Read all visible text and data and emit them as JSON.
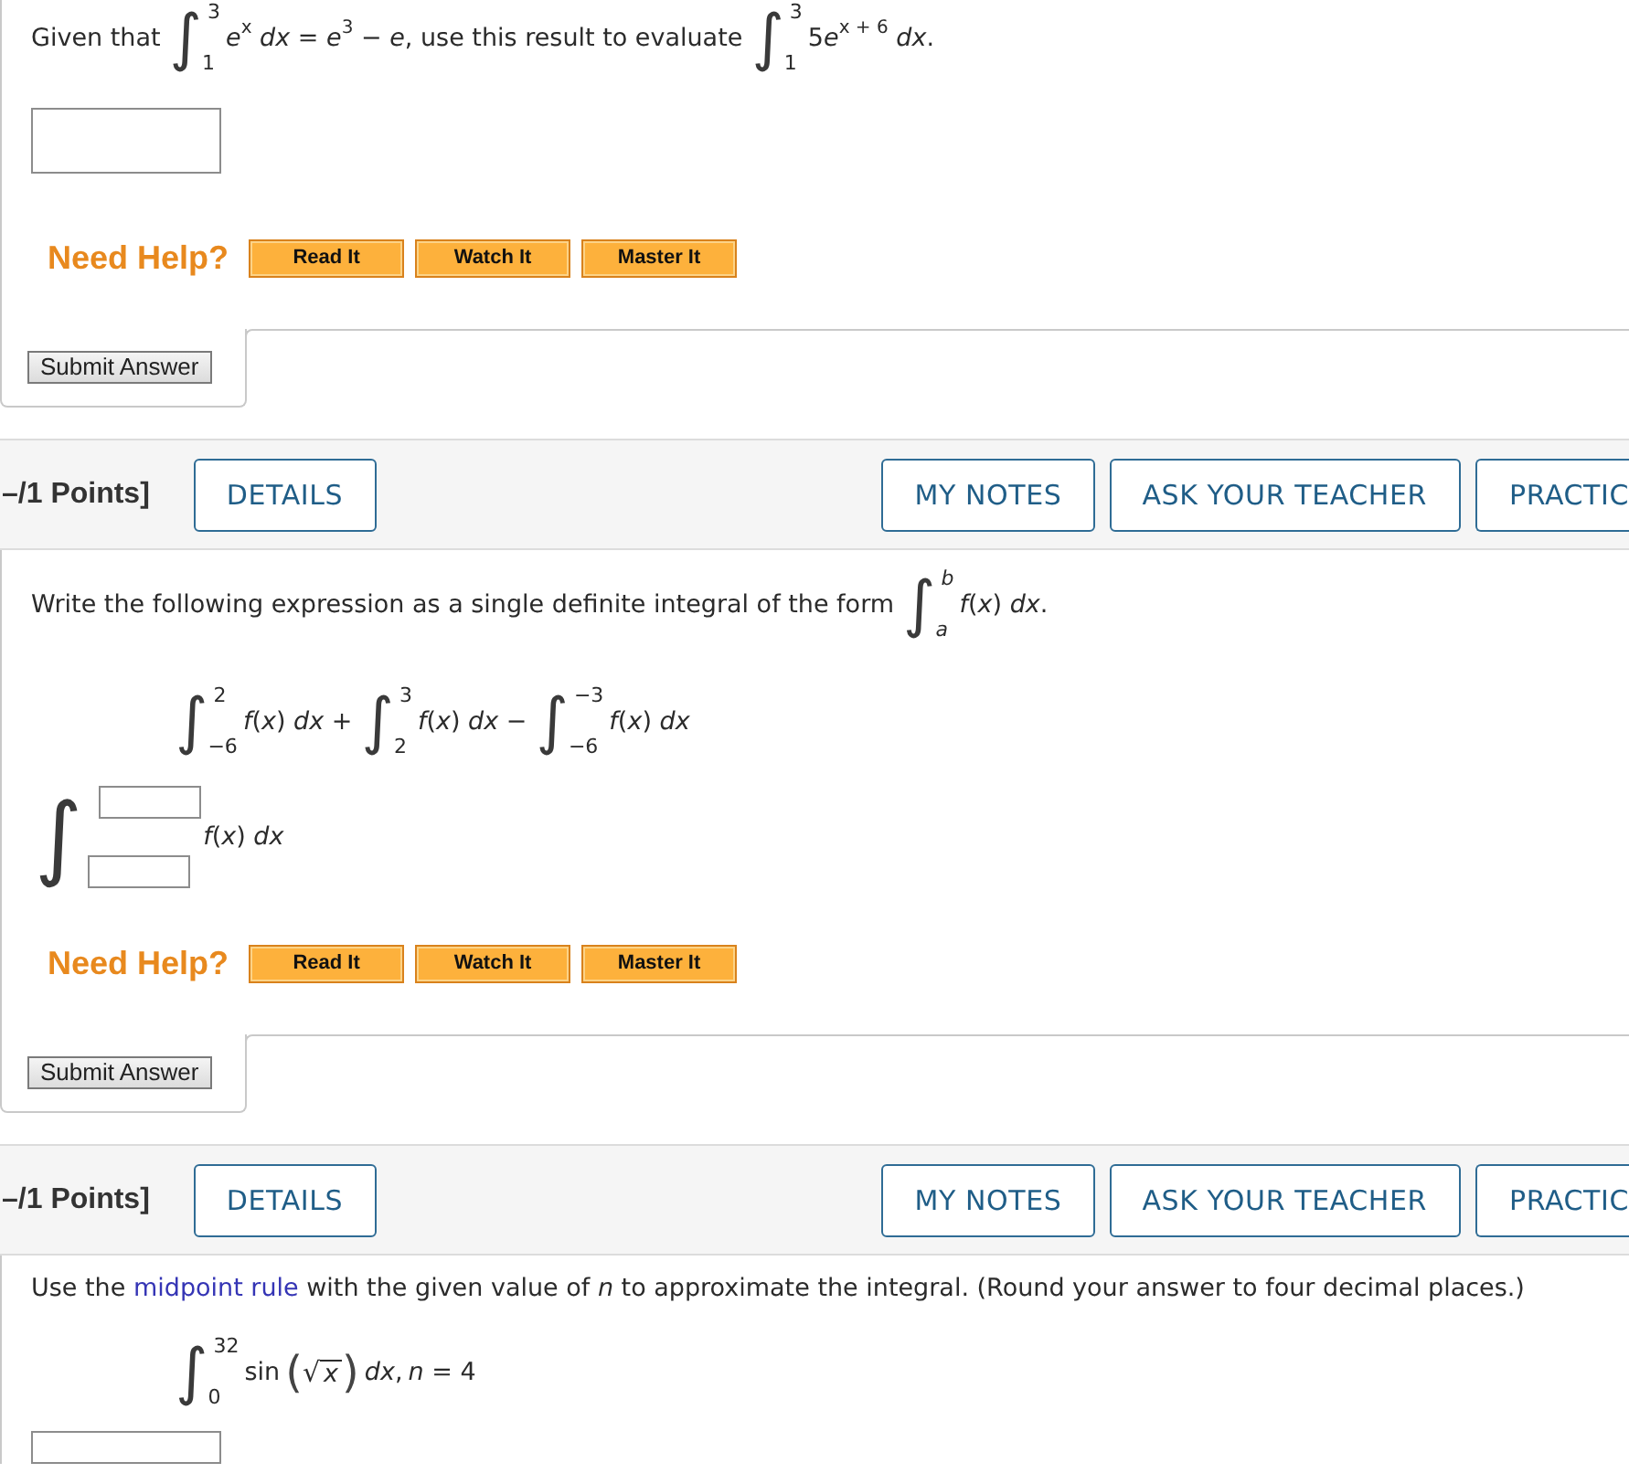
{
  "questions": [
    {
      "prompt": [
        {
          "kind": "text",
          "text": "Given that"
        },
        {
          "kind": "integral",
          "sign": "∫",
          "upper": "3",
          "lower": "1"
        },
        {
          "kind": "text",
          "text": "*e*$^{x}$ *dx* = *e*$^{3}$ − *e*, use this result to evaluate"
        },
        {
          "kind": "integral",
          "sign": "∫",
          "upper": "3",
          "lower": "1"
        },
        {
          "kind": "text",
          "text": "5⁠*e*$^{x + 6}$ *dx*."
        }
      ],
      "answer": {
        "kind": "box"
      },
      "help": {
        "label": "Need Help?",
        "buttons": [
          "Read It",
          "Watch It",
          "Master It"
        ]
      },
      "submit": "Submit Answer"
    },
    {
      "header": {
        "points": "–/1 Points]",
        "details": "DETAILS",
        "actions": [
          {
            "label": "MY NOTES",
            "clipped": false
          },
          {
            "label": "ASK YOUR TEACHER",
            "clipped": false
          },
          {
            "label": "PRACTIC",
            "clipped": true
          }
        ]
      },
      "prompt": [
        {
          "kind": "text",
          "text": "Write the following expression as a single definite integral of the form"
        },
        {
          "kind": "integral",
          "sign": "∫",
          "upper": "b",
          "lower": "a",
          "italic_limits": true
        },
        {
          "kind": "text",
          "text": "*f*(*x*) *dx*."
        }
      ],
      "expression": [
        {
          "kind": "integral",
          "sign": "∫",
          "upper": "2",
          "lower": "−6"
        },
        {
          "kind": "text",
          "text": "*f*(*x*) *dx* +"
        },
        {
          "kind": "integral",
          "sign": "∫",
          "upper": "3",
          "lower": "2"
        },
        {
          "kind": "text",
          "text": "*f*(*x*) *dx* −"
        },
        {
          "kind": "integral",
          "sign": "∫",
          "upper": "−3",
          "lower": "−6"
        },
        {
          "kind": "text",
          "text": "*f*(*x*) *dx*"
        }
      ],
      "answer": {
        "kind": "integral",
        "sign": "∫",
        "integrand": "*f*(*x*) *dx*"
      },
      "help": {
        "label": "Need Help?",
        "buttons": [
          "Read It",
          "Watch It",
          "Master It"
        ]
      },
      "submit": "Submit Answer"
    },
    {
      "header": {
        "points": "–/1 Points]",
        "details": "DETAILS",
        "actions": [
          {
            "label": "MY NOTES",
            "clipped": false
          },
          {
            "label": "ASK YOUR TEACHER",
            "clipped": false
          },
          {
            "label": "PRACTIC",
            "clipped": true
          }
        ]
      },
      "prompt": [
        {
          "kind": "sentence",
          "before": "Use the ",
          "link": "midpoint rule",
          "after": " with the given value of *n* to approximate the integral. (Round your answer to four decimal places.)"
        }
      ],
      "expression": [
        {
          "kind": "integral",
          "sign": "∫",
          "upper": "32",
          "lower": "0"
        },
        {
          "kind": "text",
          "text": "sin"
        },
        {
          "kind": "root",
          "open": "(",
          "radical": "√",
          "radicand": "x",
          "close": ")"
        },
        {
          "kind": "text",
          "text": "*dx*,"
        },
        {
          "kind": "text",
          "text": "*n* = 4"
        }
      ],
      "answer": {
        "kind": "line"
      }
    }
  ]
}
